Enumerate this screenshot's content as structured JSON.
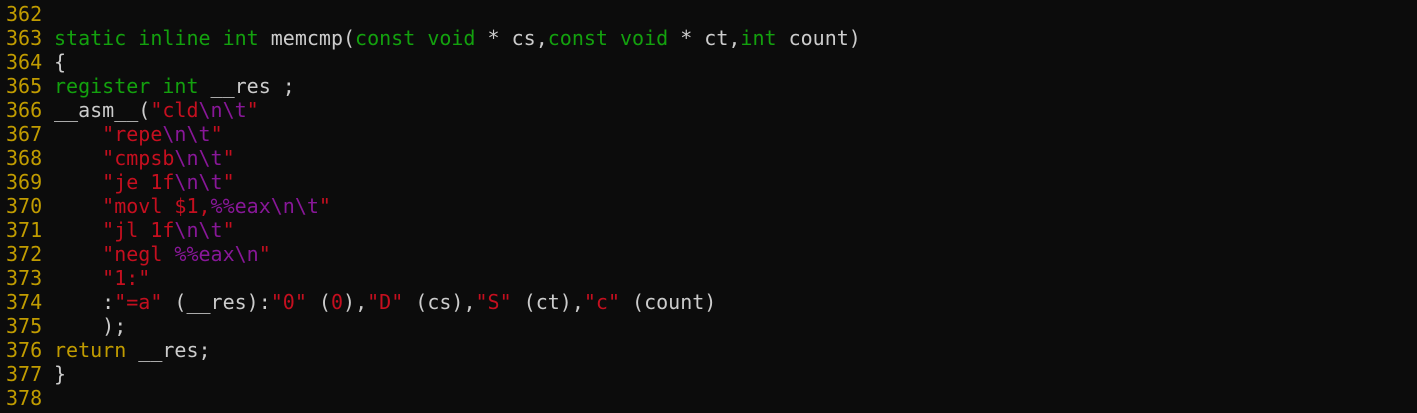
{
  "theme": {
    "background": "#0c0c0c",
    "line_number": "#c19c00",
    "keyword": "#13a10e",
    "return_keyword": "#c19c00",
    "string": "#c50f1f",
    "escape": "#881798",
    "text": "#cccccc"
  },
  "lines": [
    {
      "n": "362",
      "tokens": []
    },
    {
      "n": "363",
      "tokens": [
        {
          "t": "static",
          "c": "kw"
        },
        {
          "t": " ",
          "c": "plain"
        },
        {
          "t": "inline",
          "c": "kw"
        },
        {
          "t": " ",
          "c": "plain"
        },
        {
          "t": "int",
          "c": "kw"
        },
        {
          "t": " memcmp(",
          "c": "plain"
        },
        {
          "t": "const",
          "c": "kw"
        },
        {
          "t": " ",
          "c": "plain"
        },
        {
          "t": "void",
          "c": "kw"
        },
        {
          "t": " * cs,",
          "c": "plain"
        },
        {
          "t": "const",
          "c": "kw"
        },
        {
          "t": " ",
          "c": "plain"
        },
        {
          "t": "void",
          "c": "kw"
        },
        {
          "t": " * ct,",
          "c": "plain"
        },
        {
          "t": "int",
          "c": "kw"
        },
        {
          "t": " count)",
          "c": "plain"
        }
      ]
    },
    {
      "n": "364",
      "tokens": [
        {
          "t": "{",
          "c": "plain"
        }
      ]
    },
    {
      "n": "365",
      "tokens": [
        {
          "t": "register",
          "c": "kw"
        },
        {
          "t": " ",
          "c": "plain"
        },
        {
          "t": "int",
          "c": "kw"
        },
        {
          "t": " __res ;",
          "c": "plain"
        }
      ]
    },
    {
      "n": "366",
      "tokens": [
        {
          "t": "__asm__(",
          "c": "plain"
        },
        {
          "t": "\"cld",
          "c": "str"
        },
        {
          "t": "\\n\\t",
          "c": "esc"
        },
        {
          "t": "\"",
          "c": "str"
        }
      ]
    },
    {
      "n": "367",
      "tokens": [
        {
          "t": "    ",
          "c": "plain"
        },
        {
          "t": "\"repe",
          "c": "str"
        },
        {
          "t": "\\n\\t",
          "c": "esc"
        },
        {
          "t": "\"",
          "c": "str"
        }
      ]
    },
    {
      "n": "368",
      "tokens": [
        {
          "t": "    ",
          "c": "plain"
        },
        {
          "t": "\"cmpsb",
          "c": "str"
        },
        {
          "t": "\\n\\t",
          "c": "esc"
        },
        {
          "t": "\"",
          "c": "str"
        }
      ]
    },
    {
      "n": "369",
      "tokens": [
        {
          "t": "    ",
          "c": "plain"
        },
        {
          "t": "\"je 1f",
          "c": "str"
        },
        {
          "t": "\\n\\t",
          "c": "esc"
        },
        {
          "t": "\"",
          "c": "str"
        }
      ]
    },
    {
      "n": "370",
      "tokens": [
        {
          "t": "    ",
          "c": "plain"
        },
        {
          "t": "\"movl $1,",
          "c": "str"
        },
        {
          "t": "%%eax\\n\\t",
          "c": "esc"
        },
        {
          "t": "\"",
          "c": "str"
        }
      ]
    },
    {
      "n": "371",
      "tokens": [
        {
          "t": "    ",
          "c": "plain"
        },
        {
          "t": "\"jl 1f",
          "c": "str"
        },
        {
          "t": "\\n\\t",
          "c": "esc"
        },
        {
          "t": "\"",
          "c": "str"
        }
      ]
    },
    {
      "n": "372",
      "tokens": [
        {
          "t": "    ",
          "c": "plain"
        },
        {
          "t": "\"negl ",
          "c": "str"
        },
        {
          "t": "%%eax\\n",
          "c": "esc"
        },
        {
          "t": "\"",
          "c": "str"
        }
      ]
    },
    {
      "n": "373",
      "tokens": [
        {
          "t": "    ",
          "c": "plain"
        },
        {
          "t": "\"1:\"",
          "c": "str"
        }
      ]
    },
    {
      "n": "374",
      "tokens": [
        {
          "t": "    :",
          "c": "plain"
        },
        {
          "t": "\"=a\"",
          "c": "str"
        },
        {
          "t": " (__res):",
          "c": "plain"
        },
        {
          "t": "\"0\"",
          "c": "str"
        },
        {
          "t": " (",
          "c": "plain"
        },
        {
          "t": "0",
          "c": "num"
        },
        {
          "t": "),",
          "c": "plain"
        },
        {
          "t": "\"D\"",
          "c": "str"
        },
        {
          "t": " (cs),",
          "c": "plain"
        },
        {
          "t": "\"S\"",
          "c": "str"
        },
        {
          "t": " (ct),",
          "c": "plain"
        },
        {
          "t": "\"c\"",
          "c": "str"
        },
        {
          "t": " (count)",
          "c": "plain"
        }
      ]
    },
    {
      "n": "375",
      "tokens": [
        {
          "t": "    );",
          "c": "plain"
        }
      ]
    },
    {
      "n": "376",
      "tokens": [
        {
          "t": "return",
          "c": "ret"
        },
        {
          "t": " __res;",
          "c": "plain"
        }
      ]
    },
    {
      "n": "377",
      "tokens": [
        {
          "t": "}",
          "c": "plain"
        }
      ]
    },
    {
      "n": "378",
      "tokens": []
    }
  ]
}
